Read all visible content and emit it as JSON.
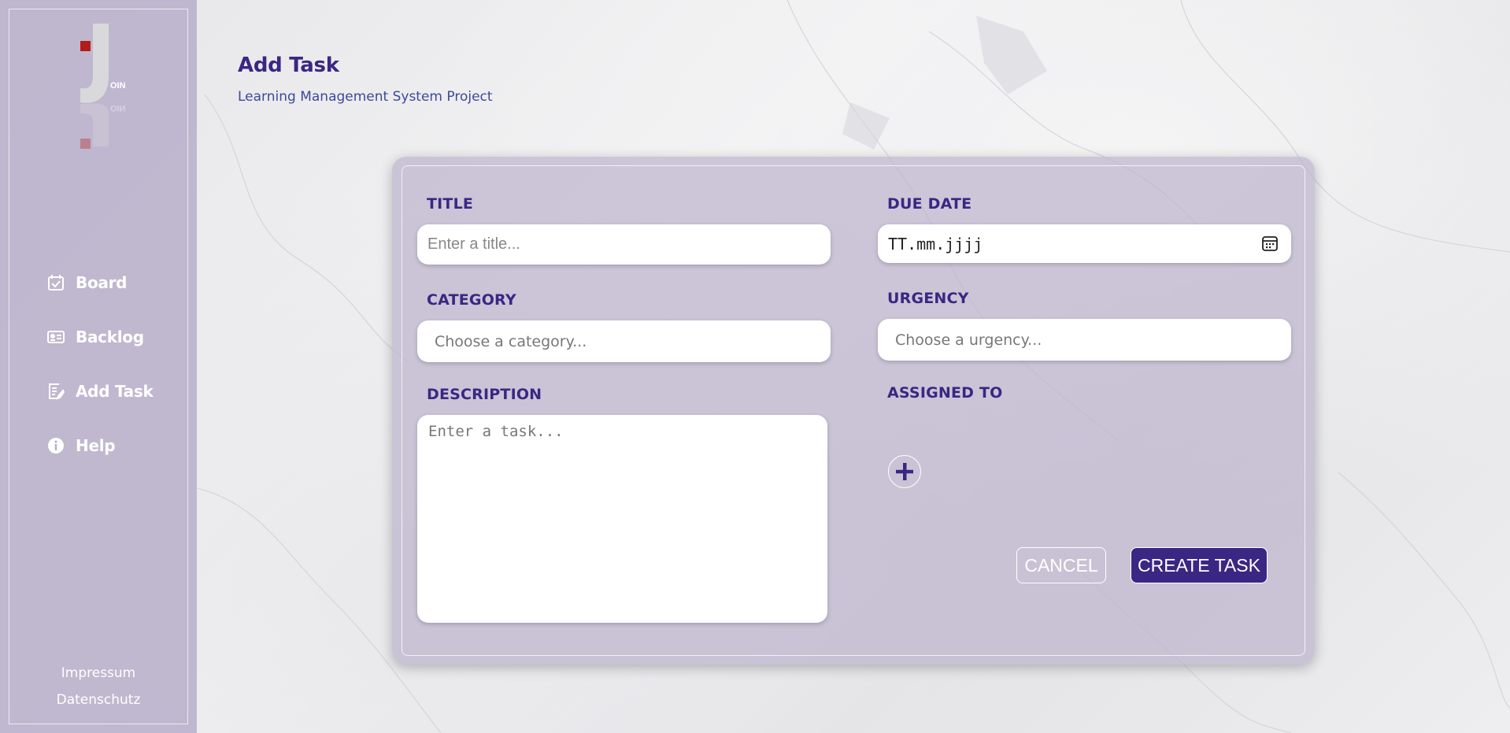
{
  "app": {
    "logo_text": "JOIN"
  },
  "sidebar": {
    "items": [
      {
        "label": "Board",
        "icon": "calendar-check-icon"
      },
      {
        "label": "Backlog",
        "icon": "id-card-icon"
      },
      {
        "label": "Add Task",
        "icon": "edit-document-icon"
      },
      {
        "label": "Help",
        "icon": "info-icon"
      }
    ],
    "footer": {
      "impressum": "Impressum",
      "datenschutz": "Datenschutz"
    }
  },
  "header": {
    "title": "Add Task",
    "subtitle": "Learning Management System Project"
  },
  "form": {
    "title_label": "TITLE",
    "title_placeholder": "Enter a title...",
    "title_value": "",
    "due_date_label": "DUE DATE",
    "due_date_value": "TT.mm.jjjj",
    "category_label": "CATEGORY",
    "category_selected": "Choose a category...",
    "urgency_label": "URGENCY",
    "urgency_selected": "Choose a urgency...",
    "description_label": "DESCRIPTION",
    "description_placeholder": "Enter a task...",
    "description_value": "",
    "assigned_label": "ASSIGNED TO",
    "cancel_label": "CANCEL",
    "create_label": "CREATE TASK"
  },
  "colors": {
    "primary": "#3b2683",
    "sidebar_bg": "#b6acc8",
    "logo_red": "#b31b1b"
  }
}
